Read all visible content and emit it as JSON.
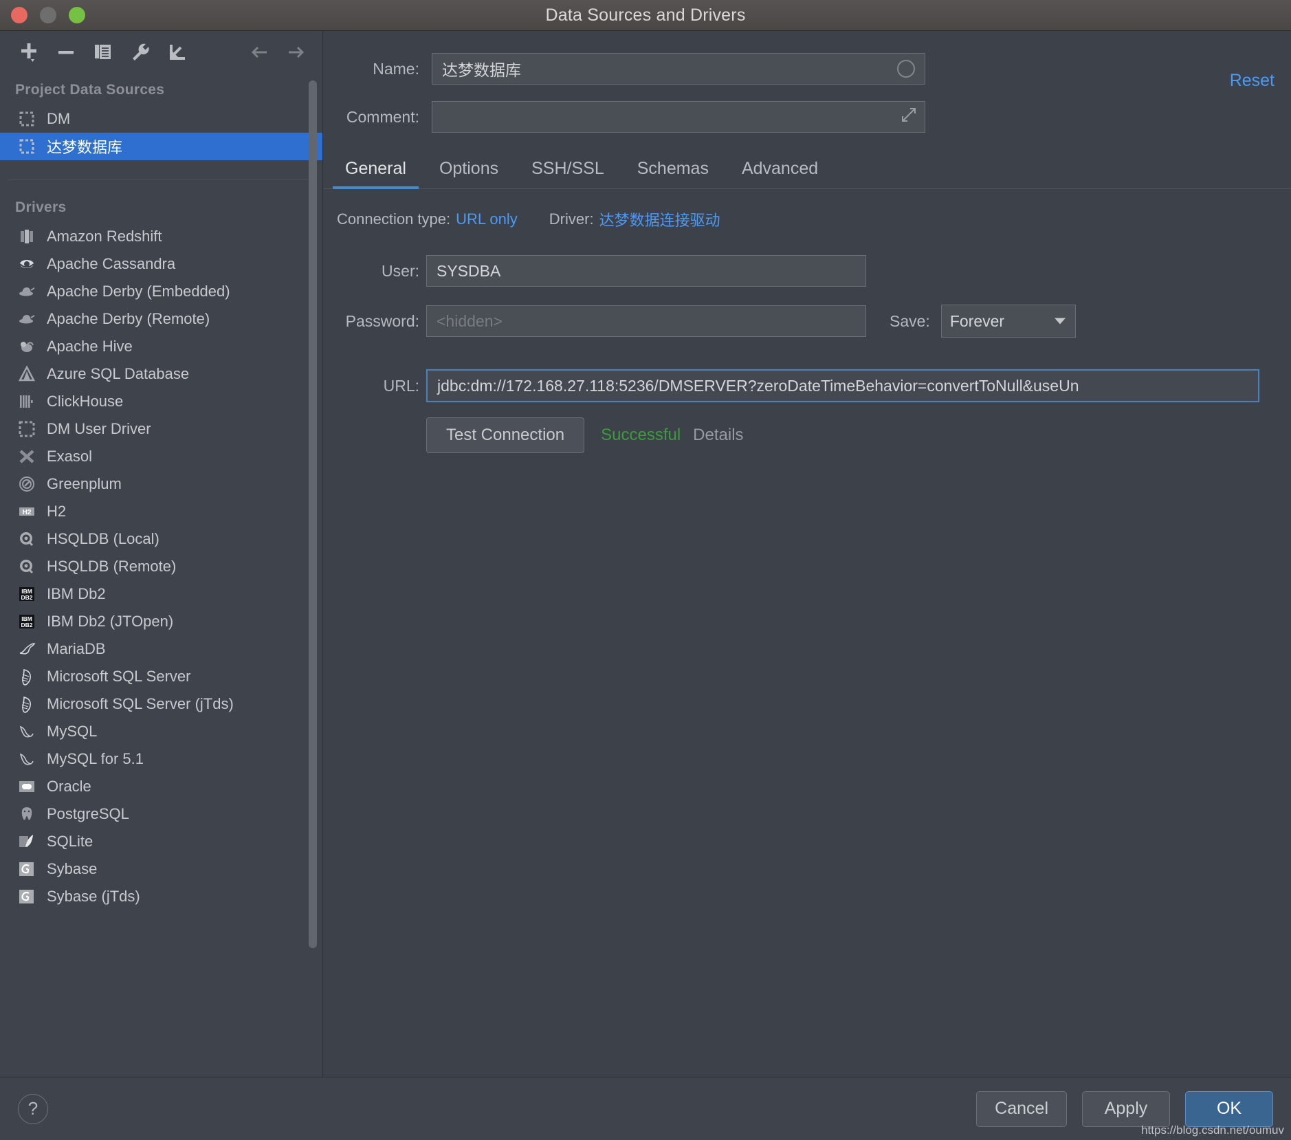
{
  "window": {
    "title": "Data Sources and Drivers",
    "traffic_lights": [
      "close",
      "minimize",
      "zoom"
    ],
    "colors": {
      "close": "#e8695f",
      "minimize": "#6e6e6e",
      "zoom": "#76c043",
      "selection_blue": "#2f6fd0",
      "link_blue": "#4b9bf5",
      "success_green": "#3c9c3c",
      "primary_button": "#3a6591"
    }
  },
  "sidebar": {
    "toolbar": [
      {
        "name": "add-icon",
        "glyph": "+"
      },
      {
        "name": "remove-icon",
        "glyph": "−"
      },
      {
        "name": "copy-icon",
        "glyph": "❐"
      },
      {
        "name": "wrench-icon",
        "glyph": "ὒ7"
      },
      {
        "name": "import-icon",
        "glyph": "↙"
      }
    ],
    "nav": [
      {
        "name": "back-arrow-icon",
        "glyph": "←"
      },
      {
        "name": "forward-arrow-icon",
        "glyph": "→"
      }
    ],
    "project_data_sources": {
      "title": "Project Data Sources",
      "items": [
        {
          "label": "DM",
          "icon": "dm-icon",
          "selected": false
        },
        {
          "label": "达梦数据库",
          "icon": "dm-icon",
          "selected": true
        }
      ]
    },
    "drivers": {
      "title": "Drivers",
      "items": [
        {
          "label": "Amazon Redshift",
          "icon": "redshift-icon"
        },
        {
          "label": "Apache Cassandra",
          "icon": "cassandra-eye-icon"
        },
        {
          "label": "Apache Derby (Embedded)",
          "icon": "derby-hat-icon"
        },
        {
          "label": "Apache Derby (Remote)",
          "icon": "derby-hat-icon"
        },
        {
          "label": "Apache Hive",
          "icon": "hive-bee-icon"
        },
        {
          "label": "Azure SQL Database",
          "icon": "azure-icon"
        },
        {
          "label": "ClickHouse",
          "icon": "clickhouse-icon"
        },
        {
          "label": "DM User Driver",
          "icon": "dm-icon"
        },
        {
          "label": "Exasol",
          "icon": "exasol-x-icon"
        },
        {
          "label": "Greenplum",
          "icon": "greenplum-icon"
        },
        {
          "label": "H2",
          "icon": "h2-icon"
        },
        {
          "label": "HSQLDB (Local)",
          "icon": "hsqldb-icon"
        },
        {
          "label": "HSQLDB (Remote)",
          "icon": "hsqldb-icon"
        },
        {
          "label": "IBM Db2",
          "icon": "ibm-db2-icon"
        },
        {
          "label": "IBM Db2 (JTOpen)",
          "icon": "ibm-db2-icon"
        },
        {
          "label": "MariaDB",
          "icon": "mariadb-seal-icon"
        },
        {
          "label": "Microsoft SQL Server",
          "icon": "mssql-icon"
        },
        {
          "label": "Microsoft SQL Server (jTds)",
          "icon": "mssql-icon"
        },
        {
          "label": "MySQL",
          "icon": "mysql-dolphin-icon"
        },
        {
          "label": "MySQL for 5.1",
          "icon": "mysql-dolphin-icon"
        },
        {
          "label": "Oracle",
          "icon": "oracle-icon"
        },
        {
          "label": "PostgreSQL",
          "icon": "postgresql-elephant-icon"
        },
        {
          "label": "SQLite",
          "icon": "sqlite-feather-icon"
        },
        {
          "label": "Sybase",
          "icon": "sybase-icon"
        },
        {
          "label": "Sybase (jTds)",
          "icon": "sybase-icon"
        }
      ]
    }
  },
  "panel": {
    "name": {
      "label": "Name:",
      "value": "达梦数据库"
    },
    "comment": {
      "label": "Comment:",
      "value": "",
      "placeholder": ""
    },
    "reset_label": "Reset",
    "tabs": [
      {
        "label": "General",
        "active": true
      },
      {
        "label": "Options",
        "active": false
      },
      {
        "label": "SSH/SSL",
        "active": false
      },
      {
        "label": "Schemas",
        "active": false
      },
      {
        "label": "Advanced",
        "active": false
      }
    ],
    "connection": {
      "type_label": "Connection type:",
      "type_value": "URL only",
      "driver_label": "Driver:",
      "driver_value": "达梦数据连接驱动"
    },
    "user": {
      "label": "User:",
      "value": "SYSDBA"
    },
    "password": {
      "label": "Password:",
      "value": "",
      "placeholder": "<hidden>"
    },
    "save": {
      "label": "Save:",
      "value": "Forever"
    },
    "url": {
      "label": "URL:",
      "value": "jdbc:dm://172.168.27.118:5236/DMSERVER?zeroDateTimeBehavior=convertToNull&useUn"
    },
    "test": {
      "button_label": "Test Connection",
      "status": "Successful",
      "details_label": "Details"
    }
  },
  "footer": {
    "help_label": "?",
    "cancel_label": "Cancel",
    "apply_label": "Apply",
    "ok_label": "OK",
    "watermark": "https://blog.csdn.net/oumuv"
  }
}
